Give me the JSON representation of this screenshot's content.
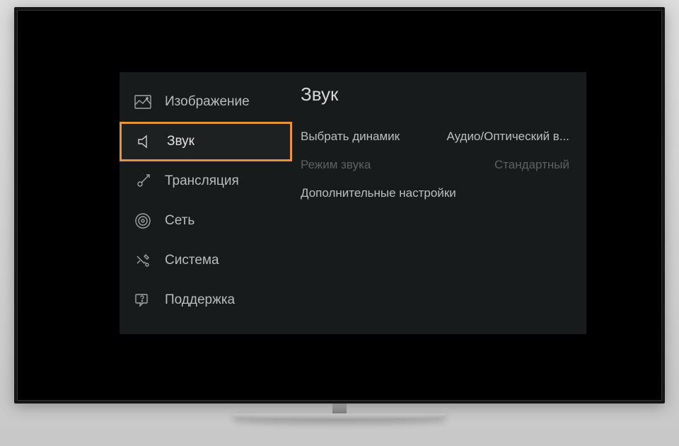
{
  "sidebar": {
    "items": [
      {
        "label": "Изображение",
        "icon": "picture-icon"
      },
      {
        "label": "Звук",
        "icon": "sound-icon"
      },
      {
        "label": "Трансляция",
        "icon": "broadcast-icon"
      },
      {
        "label": "Сеть",
        "icon": "network-icon"
      },
      {
        "label": "Система",
        "icon": "system-icon"
      },
      {
        "label": "Поддержка",
        "icon": "support-icon"
      }
    ],
    "selected_index": 1
  },
  "content": {
    "title": "Звук",
    "options": [
      {
        "label": "Выбрать динамик",
        "value": "Аудио/Оптический в...",
        "enabled": true
      },
      {
        "label": "Режим звука",
        "value": "Стандартный",
        "enabled": false
      },
      {
        "label": "Дополнительные настройки",
        "value": "",
        "enabled": true
      }
    ]
  }
}
